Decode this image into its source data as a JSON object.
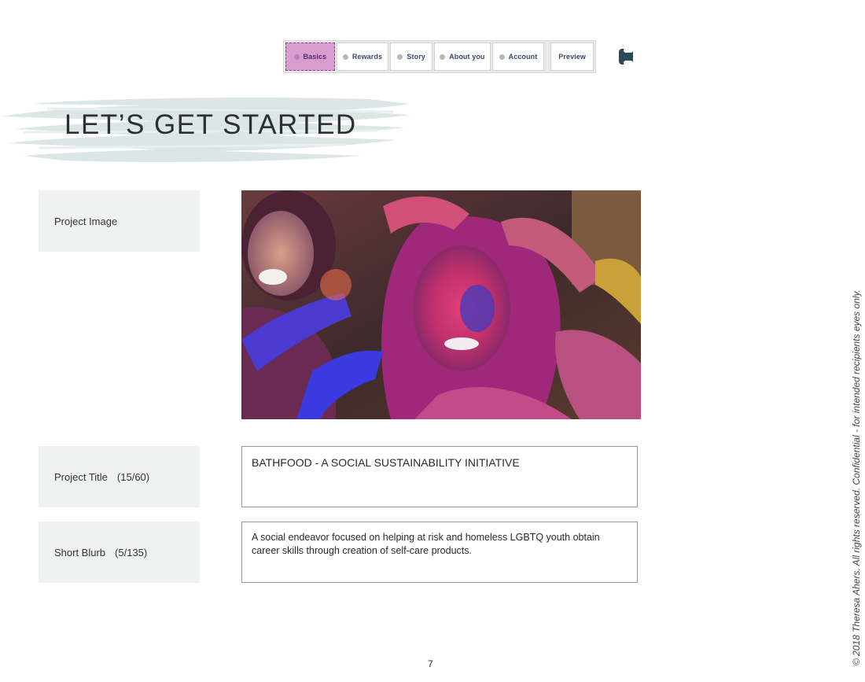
{
  "nav": {
    "tabs": [
      {
        "label": "Basics",
        "active": true
      },
      {
        "label": "Rewards",
        "active": false
      },
      {
        "label": "Story",
        "active": false
      },
      {
        "label": "About you",
        "active": false
      },
      {
        "label": "Account",
        "active": false
      }
    ],
    "preview_label": "Preview",
    "logo_icon": "kickstarter-k-icon"
  },
  "heading": "LET’S GET STARTED",
  "form": {
    "project_image": {
      "label": "Project Image"
    },
    "project_title": {
      "label": "Project Title",
      "count": "(15/60)",
      "value": "BATHFOOD - A SOCIAL SUSTAINABILITY INITIATIVE"
    },
    "short_blurb": {
      "label": "Short Blurb",
      "count": "(5/135)",
      "value": "A social endeavor focused on helping at risk and homeless LGBTQ youth obtain career skills through creation of self-care products."
    }
  },
  "page_number": "7",
  "copyright": "© 2018 Theresa Ahers. All rights reserved. Confidential - for intended recipients eyes only.",
  "colors": {
    "active_tab": "#d99ccf",
    "brush_stroke": "#dce6e7",
    "label_bg": "#f0f2f1",
    "logo": "#2b4a55"
  }
}
